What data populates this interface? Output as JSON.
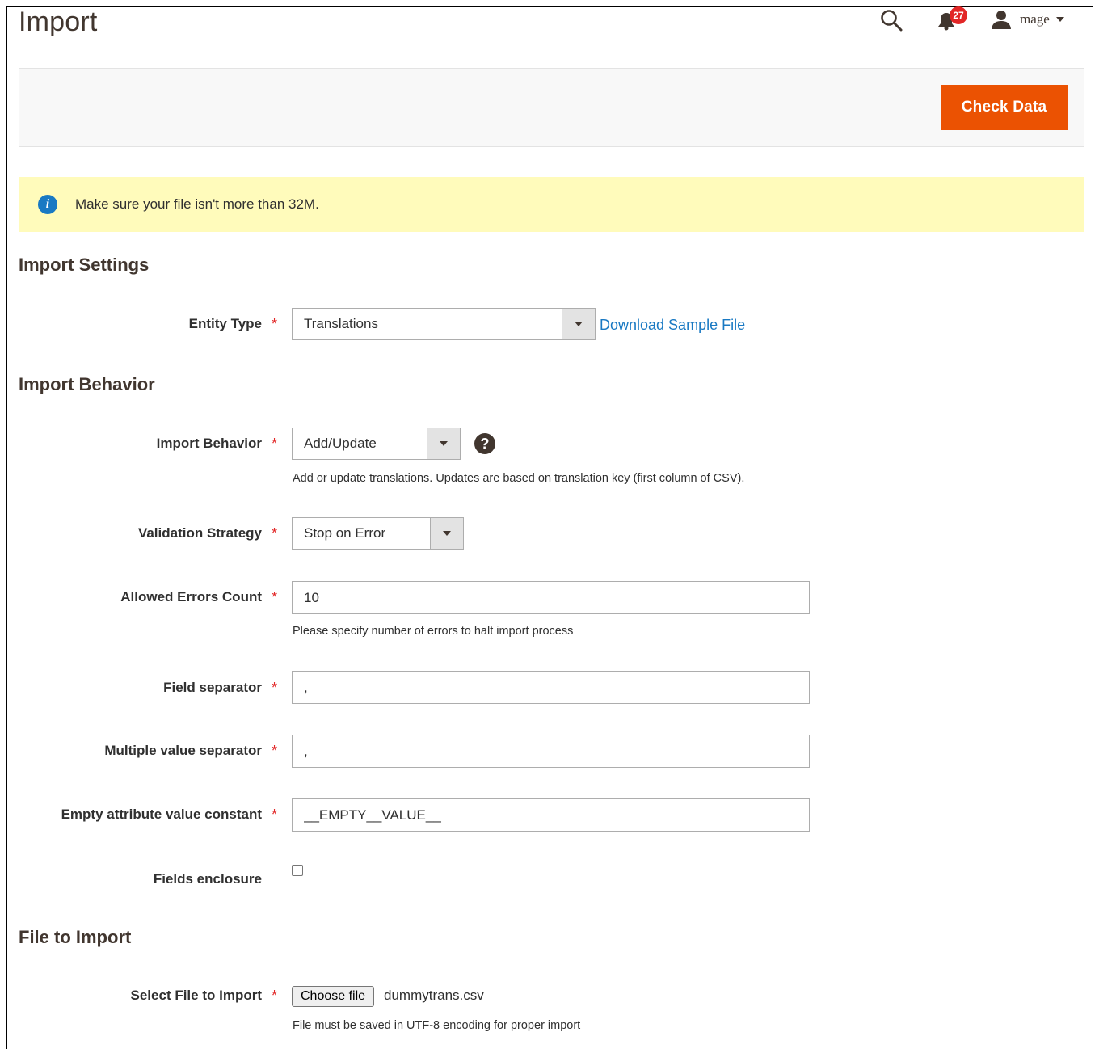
{
  "header": {
    "page_title": "Import",
    "notification_count": "27",
    "user_name": "mage"
  },
  "actions": {
    "check_data_label": "Check Data"
  },
  "notice": {
    "message": "Make sure your file isn't more than 32M."
  },
  "sections": {
    "import_settings": "Import Settings",
    "import_behavior": "Import Behavior",
    "file_to_import": "File to Import"
  },
  "fields": {
    "entity_type": {
      "label": "Entity Type",
      "value": "Translations",
      "link": "Download Sample File"
    },
    "import_behavior": {
      "label": "Import Behavior",
      "value": "Add/Update",
      "note": "Add or update translations. Updates are based on translation key (first column of CSV)."
    },
    "validation_strategy": {
      "label": "Validation Strategy",
      "value": "Stop on Error"
    },
    "allowed_errors_count": {
      "label": "Allowed Errors Count",
      "value": "10",
      "note": "Please specify number of errors to halt import process"
    },
    "field_separator": {
      "label": "Field separator",
      "value": ","
    },
    "multiple_value_separator": {
      "label": "Multiple value separator",
      "value": ","
    },
    "empty_attribute_value_constant": {
      "label": "Empty attribute value constant",
      "value": "__EMPTY__VALUE__"
    },
    "fields_enclosure": {
      "label": "Fields enclosure",
      "checked": false
    },
    "select_file": {
      "label": "Select File to Import",
      "button": "Choose file",
      "file_name": "dummytrans.csv",
      "note": "File must be saved in UTF-8 encoding for proper import"
    }
  },
  "required_marker": "*",
  "colors": {
    "accent": "#eb5202",
    "link": "#1979c3",
    "notice_bg": "#fffbbb",
    "required": "#e22626"
  },
  "icons": {
    "search": "search-icon",
    "notifications": "bell-icon",
    "user": "user-icon",
    "info": "info-icon",
    "help": "question-icon"
  }
}
